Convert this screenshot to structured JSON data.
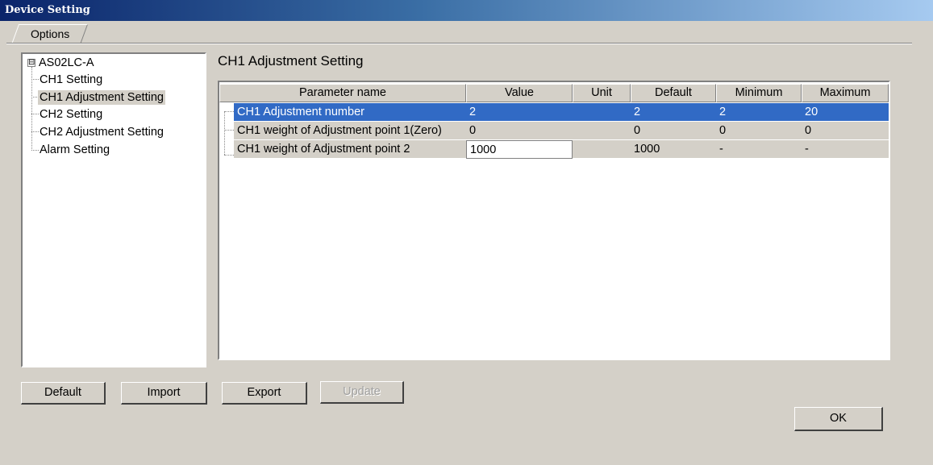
{
  "window": {
    "title": "Device Setting"
  },
  "tabs": [
    {
      "label": "Options"
    }
  ],
  "tree": {
    "root": {
      "label": "AS02LC-A",
      "expander": "⊟"
    },
    "items": [
      {
        "label": "CH1 Setting"
      },
      {
        "label": "CH1 Adjustment Setting",
        "selected": true
      },
      {
        "label": "CH2 Setting"
      },
      {
        "label": "CH2 Adjustment Setting"
      },
      {
        "label": "Alarm Setting"
      }
    ]
  },
  "main": {
    "heading": "CH1 Adjustment Setting",
    "table": {
      "columns": [
        "Parameter name",
        "Value",
        "Unit",
        "Default",
        "Minimum",
        "Maximum"
      ],
      "rows": [
        {
          "name": "CH1 Adjustment number",
          "value": "2",
          "unit": "",
          "default": "2",
          "minimum": "2",
          "maximum": "20",
          "selected": true
        },
        {
          "name": "CH1 weight of Adjustment point 1(Zero)",
          "value": "0",
          "unit": "",
          "default": "0",
          "minimum": "0",
          "maximum": "0"
        },
        {
          "name": "CH1 weight of Adjustment point 2",
          "value": "1000",
          "unit": "",
          "default": "1000",
          "minimum": "-",
          "maximum": "-",
          "editable": true
        }
      ]
    }
  },
  "buttons": {
    "default": "Default",
    "import": "Import",
    "export": "Export",
    "update": "Update",
    "ok": "OK"
  },
  "colors": {
    "selection": "#316ac5",
    "titlebar_start": "#0a246a",
    "dialog_bg": "#d4d0c8"
  }
}
